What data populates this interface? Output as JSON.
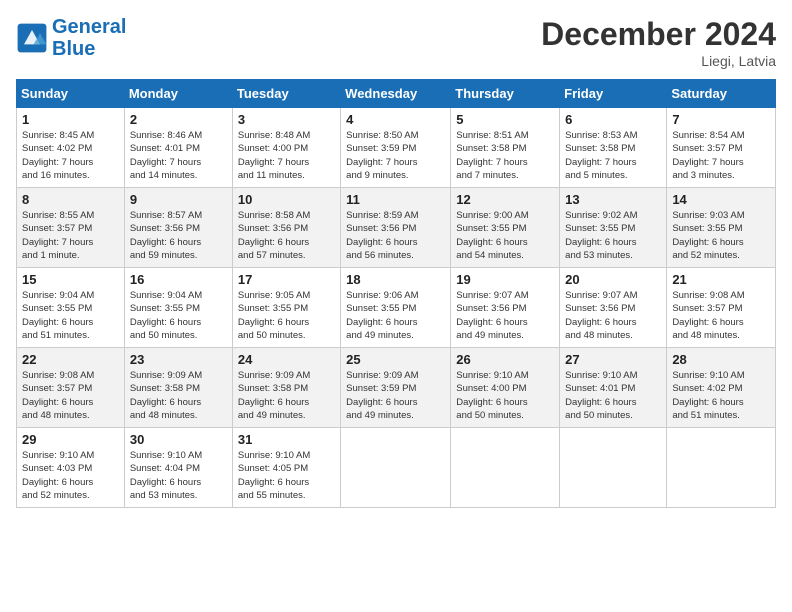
{
  "logo": {
    "line1": "General",
    "line2": "Blue"
  },
  "header": {
    "month": "December 2024",
    "location": "Liegi, Latvia"
  },
  "weekdays": [
    "Sunday",
    "Monday",
    "Tuesday",
    "Wednesday",
    "Thursday",
    "Friday",
    "Saturday"
  ],
  "weeks": [
    [
      {
        "day": "1",
        "info": "Sunrise: 8:45 AM\nSunset: 4:02 PM\nDaylight: 7 hours\nand 16 minutes."
      },
      {
        "day": "2",
        "info": "Sunrise: 8:46 AM\nSunset: 4:01 PM\nDaylight: 7 hours\nand 14 minutes."
      },
      {
        "day": "3",
        "info": "Sunrise: 8:48 AM\nSunset: 4:00 PM\nDaylight: 7 hours\nand 11 minutes."
      },
      {
        "day": "4",
        "info": "Sunrise: 8:50 AM\nSunset: 3:59 PM\nDaylight: 7 hours\nand 9 minutes."
      },
      {
        "day": "5",
        "info": "Sunrise: 8:51 AM\nSunset: 3:58 PM\nDaylight: 7 hours\nand 7 minutes."
      },
      {
        "day": "6",
        "info": "Sunrise: 8:53 AM\nSunset: 3:58 PM\nDaylight: 7 hours\nand 5 minutes."
      },
      {
        "day": "7",
        "info": "Sunrise: 8:54 AM\nSunset: 3:57 PM\nDaylight: 7 hours\nand 3 minutes."
      }
    ],
    [
      {
        "day": "8",
        "info": "Sunrise: 8:55 AM\nSunset: 3:57 PM\nDaylight: 7 hours\nand 1 minute."
      },
      {
        "day": "9",
        "info": "Sunrise: 8:57 AM\nSunset: 3:56 PM\nDaylight: 6 hours\nand 59 minutes."
      },
      {
        "day": "10",
        "info": "Sunrise: 8:58 AM\nSunset: 3:56 PM\nDaylight: 6 hours\nand 57 minutes."
      },
      {
        "day": "11",
        "info": "Sunrise: 8:59 AM\nSunset: 3:56 PM\nDaylight: 6 hours\nand 56 minutes."
      },
      {
        "day": "12",
        "info": "Sunrise: 9:00 AM\nSunset: 3:55 PM\nDaylight: 6 hours\nand 54 minutes."
      },
      {
        "day": "13",
        "info": "Sunrise: 9:02 AM\nSunset: 3:55 PM\nDaylight: 6 hours\nand 53 minutes."
      },
      {
        "day": "14",
        "info": "Sunrise: 9:03 AM\nSunset: 3:55 PM\nDaylight: 6 hours\nand 52 minutes."
      }
    ],
    [
      {
        "day": "15",
        "info": "Sunrise: 9:04 AM\nSunset: 3:55 PM\nDaylight: 6 hours\nand 51 minutes."
      },
      {
        "day": "16",
        "info": "Sunrise: 9:04 AM\nSunset: 3:55 PM\nDaylight: 6 hours\nand 50 minutes."
      },
      {
        "day": "17",
        "info": "Sunrise: 9:05 AM\nSunset: 3:55 PM\nDaylight: 6 hours\nand 50 minutes."
      },
      {
        "day": "18",
        "info": "Sunrise: 9:06 AM\nSunset: 3:55 PM\nDaylight: 6 hours\nand 49 minutes."
      },
      {
        "day": "19",
        "info": "Sunrise: 9:07 AM\nSunset: 3:56 PM\nDaylight: 6 hours\nand 49 minutes."
      },
      {
        "day": "20",
        "info": "Sunrise: 9:07 AM\nSunset: 3:56 PM\nDaylight: 6 hours\nand 48 minutes."
      },
      {
        "day": "21",
        "info": "Sunrise: 9:08 AM\nSunset: 3:57 PM\nDaylight: 6 hours\nand 48 minutes."
      }
    ],
    [
      {
        "day": "22",
        "info": "Sunrise: 9:08 AM\nSunset: 3:57 PM\nDaylight: 6 hours\nand 48 minutes."
      },
      {
        "day": "23",
        "info": "Sunrise: 9:09 AM\nSunset: 3:58 PM\nDaylight: 6 hours\nand 48 minutes."
      },
      {
        "day": "24",
        "info": "Sunrise: 9:09 AM\nSunset: 3:58 PM\nDaylight: 6 hours\nand 49 minutes."
      },
      {
        "day": "25",
        "info": "Sunrise: 9:09 AM\nSunset: 3:59 PM\nDaylight: 6 hours\nand 49 minutes."
      },
      {
        "day": "26",
        "info": "Sunrise: 9:10 AM\nSunset: 4:00 PM\nDaylight: 6 hours\nand 50 minutes."
      },
      {
        "day": "27",
        "info": "Sunrise: 9:10 AM\nSunset: 4:01 PM\nDaylight: 6 hours\nand 50 minutes."
      },
      {
        "day": "28",
        "info": "Sunrise: 9:10 AM\nSunset: 4:02 PM\nDaylight: 6 hours\nand 51 minutes."
      }
    ],
    [
      {
        "day": "29",
        "info": "Sunrise: 9:10 AM\nSunset: 4:03 PM\nDaylight: 6 hours\nand 52 minutes."
      },
      {
        "day": "30",
        "info": "Sunrise: 9:10 AM\nSunset: 4:04 PM\nDaylight: 6 hours\nand 53 minutes."
      },
      {
        "day": "31",
        "info": "Sunrise: 9:10 AM\nSunset: 4:05 PM\nDaylight: 6 hours\nand 55 minutes."
      },
      {
        "day": "",
        "info": ""
      },
      {
        "day": "",
        "info": ""
      },
      {
        "day": "",
        "info": ""
      },
      {
        "day": "",
        "info": ""
      }
    ]
  ]
}
